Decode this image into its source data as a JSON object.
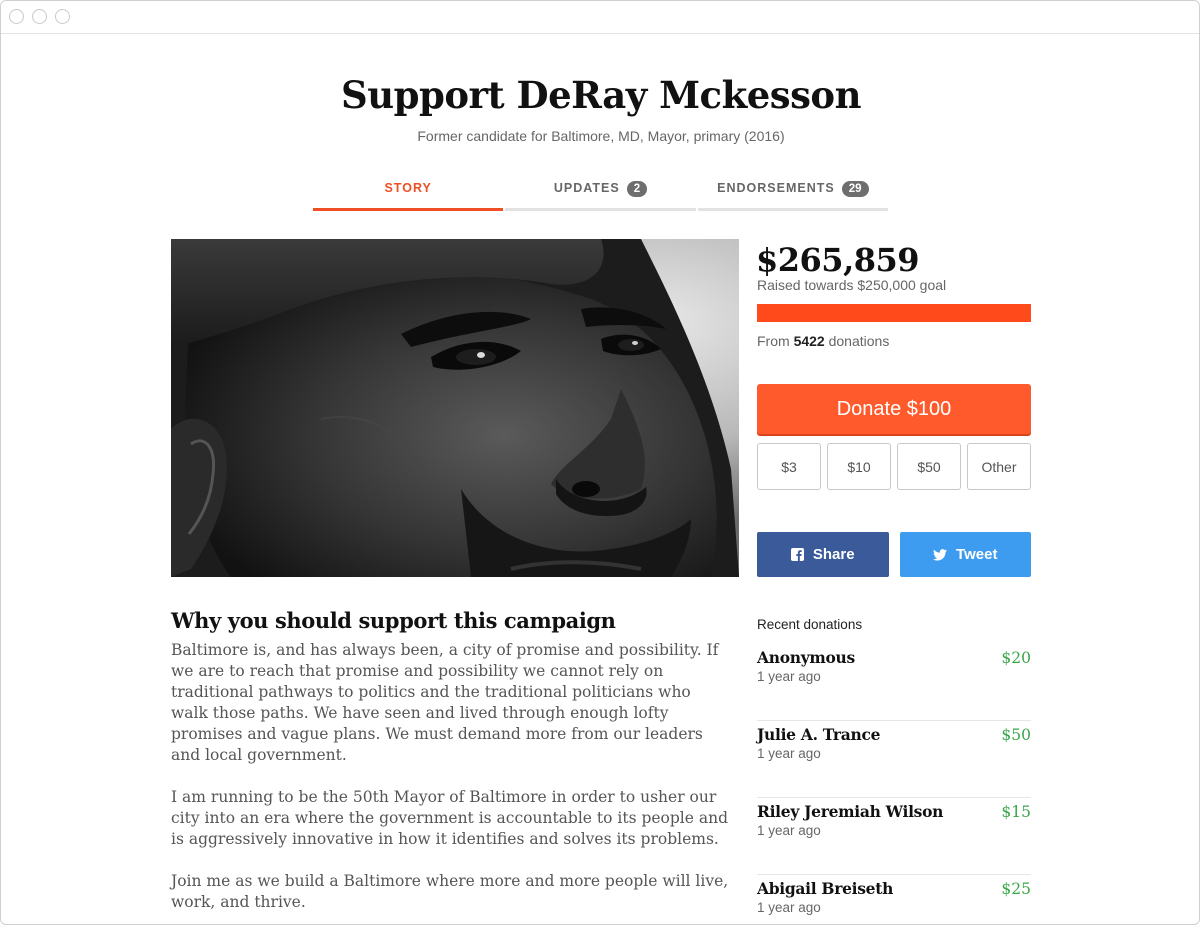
{
  "header": {
    "title": "Support DeRay Mckesson",
    "subtitle": "Former candidate for Baltimore, MD, Mayor, primary (2016)"
  },
  "tabs": [
    {
      "label": "STORY",
      "badge": null,
      "active": true
    },
    {
      "label": "UPDATES",
      "badge": "2",
      "active": false
    },
    {
      "label": "ENDORSEMENTS",
      "badge": "29",
      "active": false
    }
  ],
  "hero_image": {
    "icon": "portrait-photo"
  },
  "fundraising": {
    "amount": "$265,859",
    "goal_text": "Raised towards $250,000 goal",
    "progress_percent": 100,
    "donations_prefix": "From",
    "donations_count": "5422",
    "donations_suffix": "donations"
  },
  "donate": {
    "main_label": "Donate $100",
    "options": [
      "$3",
      "$10",
      "$50",
      "Other"
    ]
  },
  "share": {
    "facebook_label": "Share",
    "twitter_label": "Tweet",
    "facebook_icon": "facebook-icon",
    "twitter_icon": "twitter-icon"
  },
  "story": {
    "heading": "Why you should support this campaign",
    "paragraphs": [
      "Baltimore is, and has always been, a city of promise and possibility. If we are to reach that promise and possibility we cannot rely on traditional pathways to politics and the traditional politicians who walk those paths. We have seen and lived through enough lofty promises and vague plans. We must demand more from our leaders and local government.",
      "I am running to be the 50th Mayor of Baltimore in order to usher our city into an era where the government is accountable to its people and is aggressively innovative in how it identifies and solves its problems.",
      "Join me as we build a Baltimore where more and more people will live, work, and thrive."
    ]
  },
  "recent_donations": {
    "title": "Recent donations",
    "items": [
      {
        "name": "Anonymous",
        "time": "1 year ago",
        "amount": "$20"
      },
      {
        "name": "Julie A. Trance",
        "time": "1 year ago",
        "amount": "$50"
      },
      {
        "name": "Riley Jeremiah Wilson",
        "time": "1 year ago",
        "amount": "$15"
      },
      {
        "name": "Abigail Breiseth",
        "time": "1 year ago",
        "amount": "$25"
      }
    ]
  },
  "colors": {
    "accent": "#f04e23",
    "donate": "#ff5a2c",
    "facebook": "#3b5a9a",
    "twitter": "#3d9cf0",
    "donation_amount": "#3aa64a"
  }
}
